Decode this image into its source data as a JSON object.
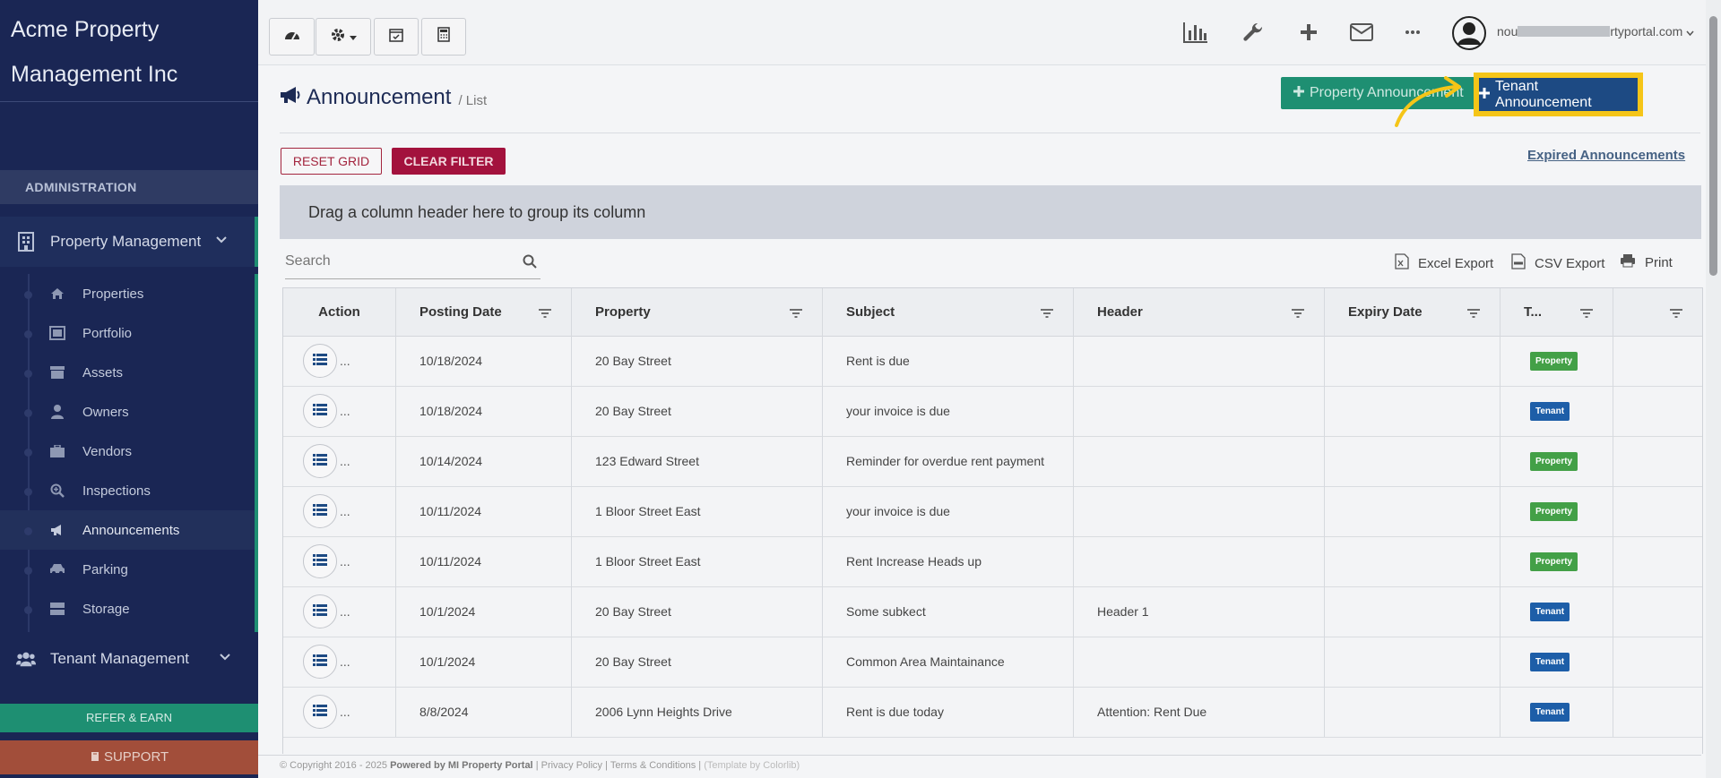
{
  "brand": {
    "line1": "Acme Property",
    "line2": "Management Inc"
  },
  "sidebar": {
    "admin_heading": "ADMINISTRATION",
    "property_group": "Property Management",
    "items": [
      {
        "label": "Properties",
        "icon": "home-icon"
      },
      {
        "label": "Portfolio",
        "icon": "portfolio-icon"
      },
      {
        "label": "Assets",
        "icon": "archive-icon"
      },
      {
        "label": "Owners",
        "icon": "user-icon"
      },
      {
        "label": "Vendors",
        "icon": "briefcase-icon"
      },
      {
        "label": "Inspections",
        "icon": "search-plus-icon"
      },
      {
        "label": "Announcements",
        "icon": "megaphone-icon",
        "active": true
      },
      {
        "label": "Parking",
        "icon": "car-icon"
      },
      {
        "label": "Storage",
        "icon": "storage-icon"
      }
    ],
    "tenant_group": "Tenant Management",
    "refer": "REFER & EARN",
    "support": "SUPPORT"
  },
  "topbar": {
    "user_email": "nou",
    "user_email_suffix": "rtyportal.com"
  },
  "page": {
    "title": "Announcement",
    "subtitle": "/ List",
    "property_announcement_btn": "Property Announcement",
    "tenant_announcement_btn": "Tenant Announcement",
    "expired_link": "Expired Announcements",
    "reset_grid": "RESET GRID",
    "clear_filter": "CLEAR FILTER",
    "group_hint": "Drag a column header here to group its column",
    "search_placeholder": "Search",
    "excel_export": "Excel Export",
    "csv_export": "CSV Export",
    "print": "Print"
  },
  "table": {
    "headers": [
      "Action",
      "Posting Date",
      "Property",
      "Subject",
      "Header",
      "Expiry Date",
      "T...",
      ""
    ],
    "rows": [
      {
        "date": "10/18/2024",
        "property": "20 Bay Street",
        "subject": "Rent is due",
        "header": "",
        "expiry": "",
        "type": "Property"
      },
      {
        "date": "10/18/2024",
        "property": "20 Bay Street",
        "subject": "your invoice is due",
        "header": "",
        "expiry": "",
        "type": "Tenant"
      },
      {
        "date": "10/14/2024",
        "property": "123 Edward Street",
        "subject": "Reminder for overdue rent payment",
        "header": "",
        "expiry": "",
        "type": "Property"
      },
      {
        "date": "10/11/2024",
        "property": "1 Bloor Street East",
        "subject": "your invoice is due",
        "header": "",
        "expiry": "",
        "type": "Property"
      },
      {
        "date": "10/11/2024",
        "property": "1 Bloor Street East",
        "subject": "Rent Increase Heads up",
        "header": "",
        "expiry": "",
        "type": "Property"
      },
      {
        "date": "10/1/2024",
        "property": "20 Bay Street",
        "subject": "Some subkect",
        "header": "Header 1",
        "expiry": "",
        "type": "Tenant"
      },
      {
        "date": "10/1/2024",
        "property": "20 Bay Street",
        "subject": "Common Area Maintainance",
        "header": "",
        "expiry": "",
        "type": "Tenant"
      },
      {
        "date": "8/8/2024",
        "property": "2006 Lynn Heights Drive",
        "subject": "Rent is due today",
        "header": "Attention: Rent Due",
        "expiry": "",
        "type": "Tenant"
      }
    ],
    "row_dots": "..."
  },
  "footer": {
    "copyright": "© Copyright 2016 - 2025",
    "powered": "Powered by MI Property Portal",
    "links": "| Privacy Policy | Terms & Conditions |",
    "template": "(Template by Colorlib)"
  },
  "colors": {
    "sidebar": "#1a2654",
    "accent_green": "#1e8f72",
    "tenant_blue": "#1d4a83",
    "highlight_yellow": "#f5c518",
    "danger": "#a3123d"
  }
}
